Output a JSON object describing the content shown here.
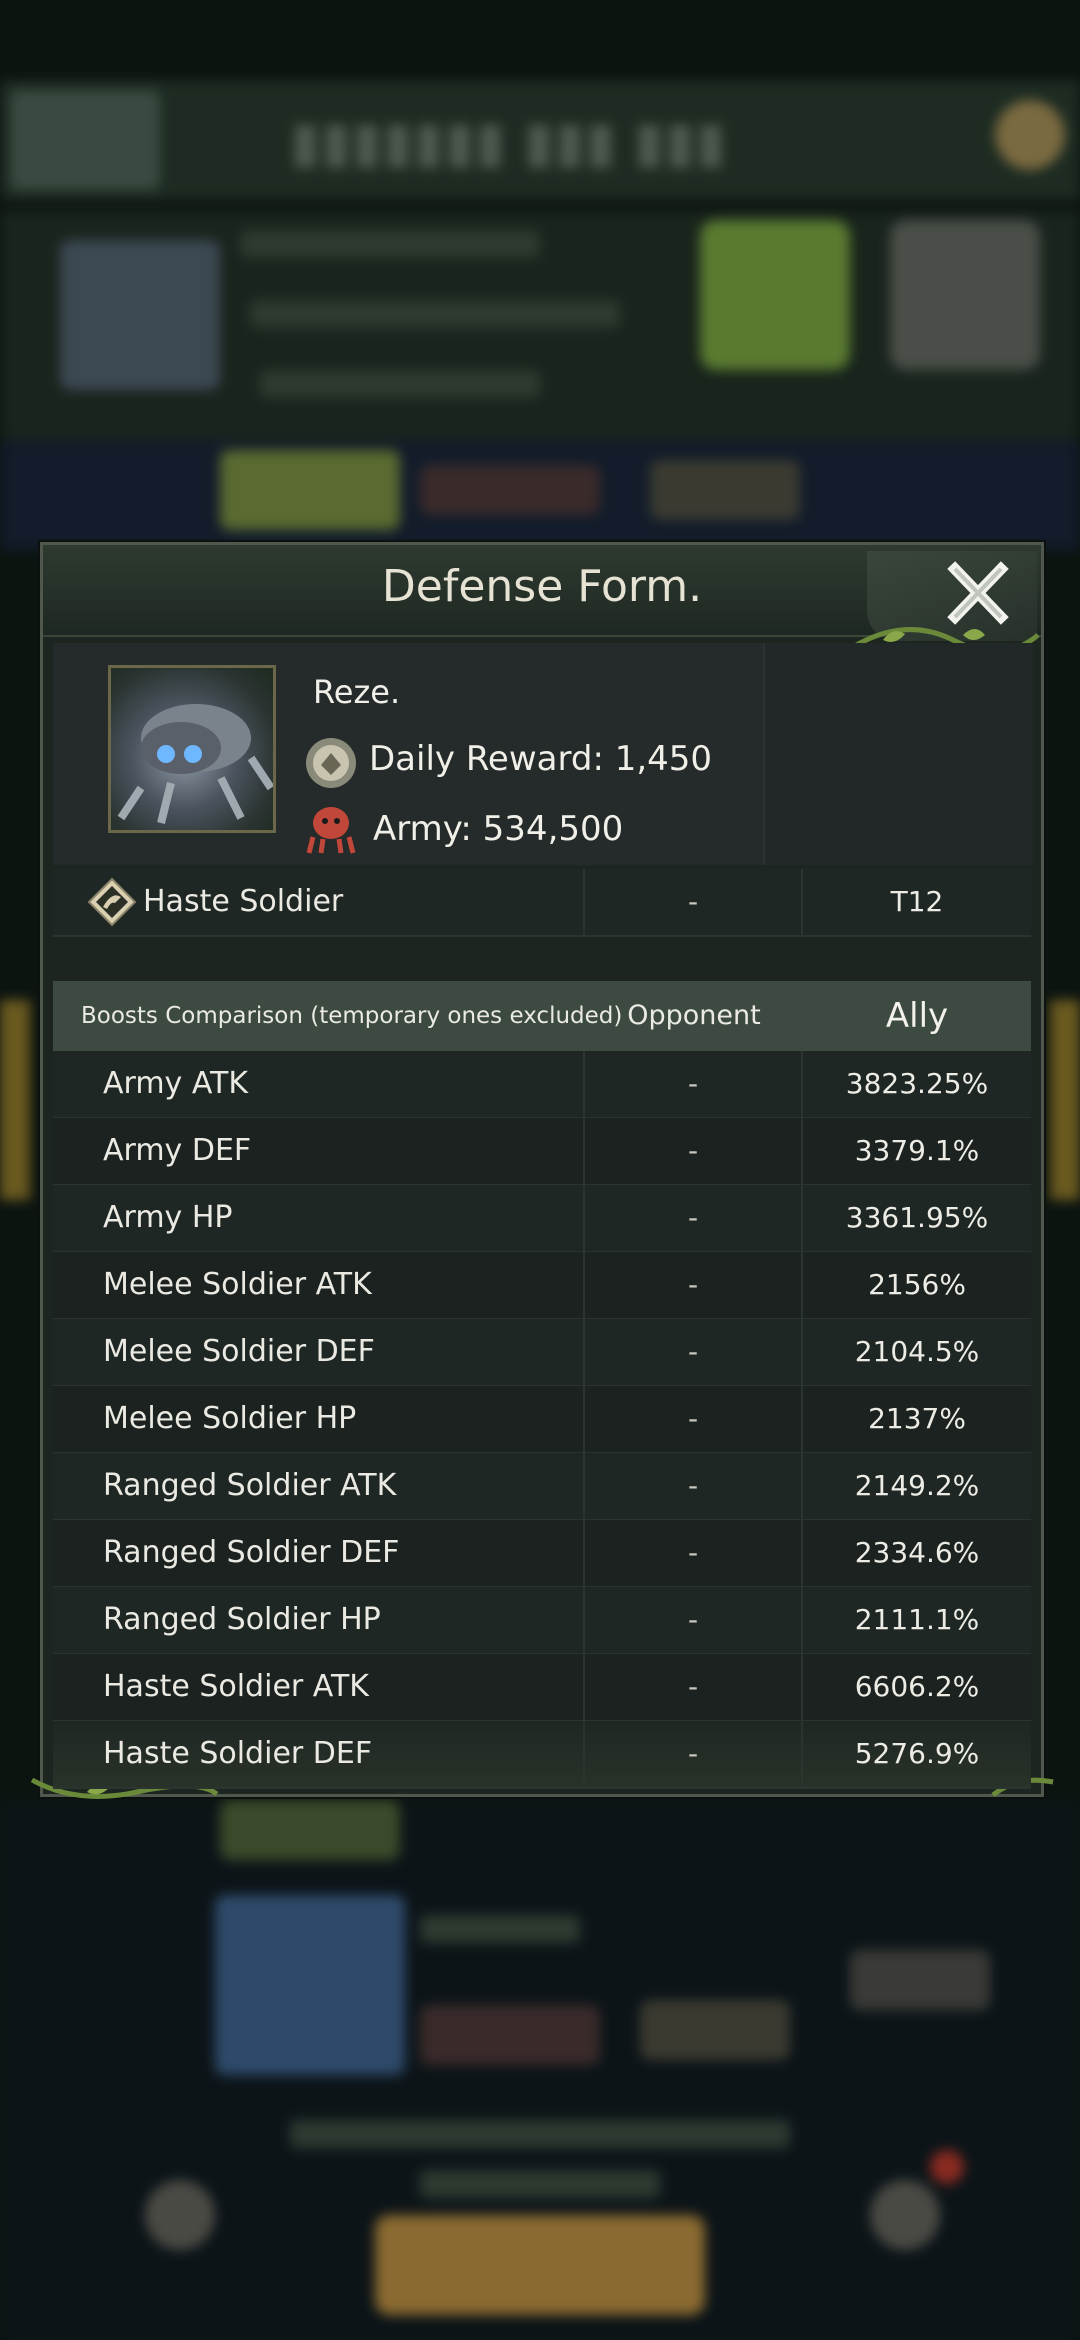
{
  "dialog": {
    "title": "Defense Form.",
    "player": {
      "name": "Reze.",
      "daily_reward": "Daily Reward: 1,450",
      "army": "Army: 534,500"
    },
    "troop_row": {
      "label": "Haste Soldier",
      "opponent": "-",
      "ally": "T12"
    },
    "table": {
      "headers": {
        "boost": "Boosts Comparison (temporary ones excluded)",
        "opponent": "Opponent",
        "ally": "Ally"
      },
      "rows": [
        {
          "label": "Army ATK",
          "opponent": "-",
          "ally": "3823.25%"
        },
        {
          "label": "Army DEF",
          "opponent": "-",
          "ally": "3379.1%"
        },
        {
          "label": "Army HP",
          "opponent": "-",
          "ally": "3361.95%"
        },
        {
          "label": "Melee Soldier ATK",
          "opponent": "-",
          "ally": "2156%"
        },
        {
          "label": "Melee Soldier DEF",
          "opponent": "-",
          "ally": "2104.5%"
        },
        {
          "label": "Melee Soldier HP",
          "opponent": "-",
          "ally": "2137%"
        },
        {
          "label": "Ranged Soldier ATK",
          "opponent": "-",
          "ally": "2149.2%"
        },
        {
          "label": "Ranged Soldier DEF",
          "opponent": "-",
          "ally": "2334.6%"
        },
        {
          "label": "Ranged Soldier HP",
          "opponent": "-",
          "ally": "2111.1%"
        },
        {
          "label": "Haste Soldier ATK",
          "opponent": "-",
          "ally": "6606.2%"
        },
        {
          "label": "Haste Soldier DEF",
          "opponent": "-",
          "ally": "5276.9%"
        }
      ]
    }
  },
  "icons": {
    "close": "close-x-icon",
    "reward": "reward-medal-icon",
    "army": "army-soldier-icon",
    "troop": "haste-soldier-icon"
  },
  "colors": {
    "dialog_bg": "#1c2520",
    "header_row_bg": "#3c4a42",
    "text": "#eaeae2",
    "vine_green": "#6a8a3a"
  }
}
